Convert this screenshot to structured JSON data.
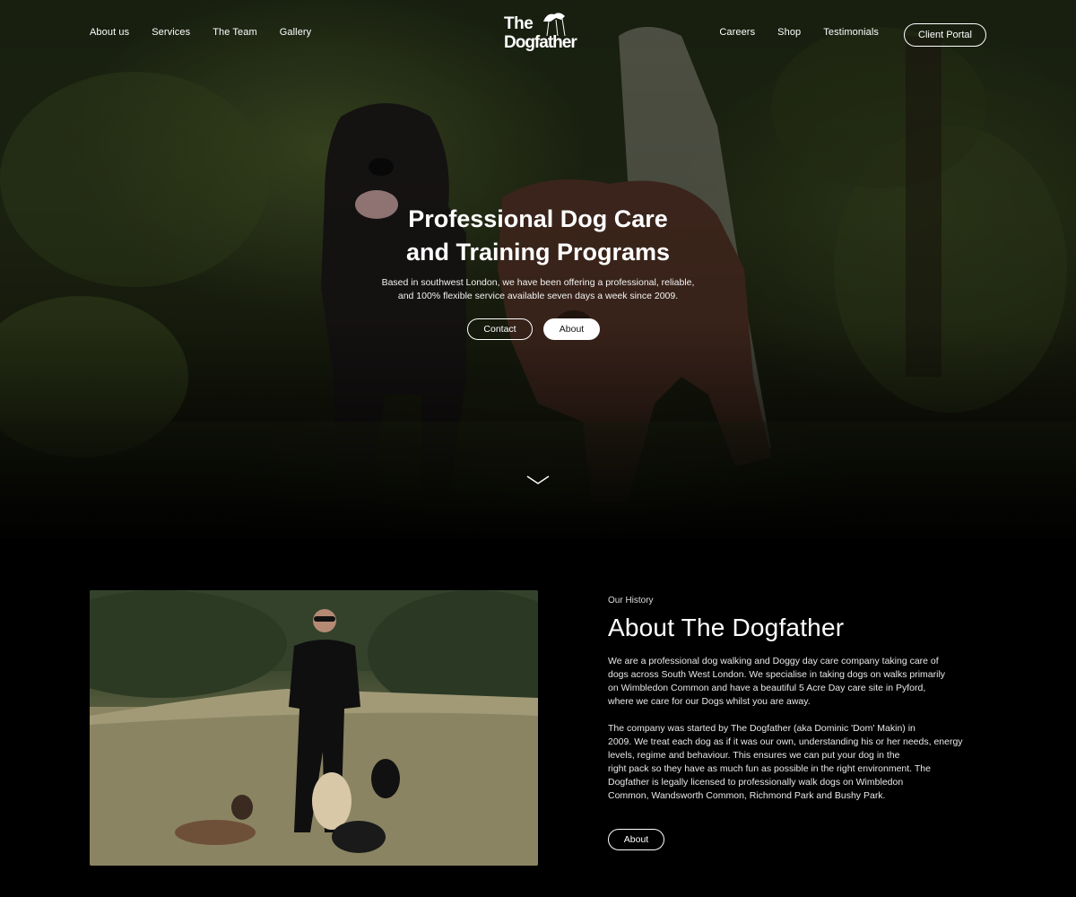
{
  "nav": {
    "left_links": [
      "About us",
      "Services",
      "The Team",
      "Gallery"
    ],
    "right_links": [
      "Careers",
      "Shop",
      "Testimonials"
    ],
    "logo_line1": "The",
    "logo_line2": "Dogfather",
    "portal_label": "Client Portal"
  },
  "hero": {
    "title_line1": "Professional Dog Care",
    "title_line2": "and Training Programs",
    "subtitle_line1": "Based in southwest London, we have been offering a professional, reliable,",
    "subtitle_line2": "and 100% flexible service available seven days a week since 2009.",
    "contact_label": "Contact",
    "about_label": "About",
    "scroll_icon": "chevron-down-icon"
  },
  "about": {
    "eyebrow": "Our History",
    "title": "About The Dogfather",
    "p1_lines": [
      "We are a professional dog walking and Doggy day care company taking care of",
      "dogs across South West London. We specialise in taking dogs on walks primarily",
      "on Wimbledon Common and have a beautiful 5 Acre Day care site in Pyford,",
      "where we care for our Dogs whilst you are away."
    ],
    "p2_lines": [
      "The company was started by The Dogfather (aka Dominic 'Dom' Makin) in",
      "2009. We treat each dog as if it was our own, understanding his or her needs, energy",
      "levels, regime and behaviour. This ensures we can put your dog in the",
      "right pack so they have as much fun as possible in the right environment. The",
      "Dogfather is legally licensed to professionally walk dogs on Wimbledon",
      "Common, Wandsworth Common, Richmond Park and Bushy Park."
    ],
    "button_label": "About"
  }
}
